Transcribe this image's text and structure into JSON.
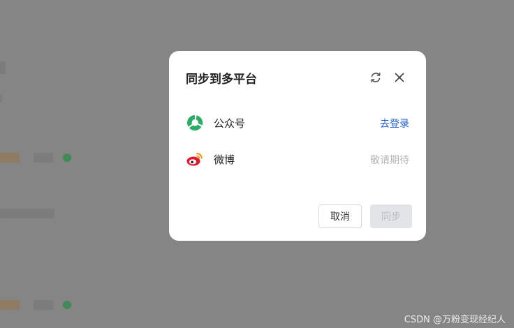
{
  "dialog": {
    "title": "同步到多平台",
    "refresh_icon": "refresh-icon",
    "close_icon": "close-icon",
    "platforms": [
      {
        "name": "公众号",
        "icon": "wechat-official-account-icon",
        "action": "去登录",
        "action_color": "#1f5fd1"
      },
      {
        "name": "微博",
        "icon": "weibo-icon",
        "status": "敬请期待"
      }
    ],
    "cancel_label": "取消",
    "sync_label": "同步"
  },
  "watermark": "CSDN @万粉变现经纪人"
}
